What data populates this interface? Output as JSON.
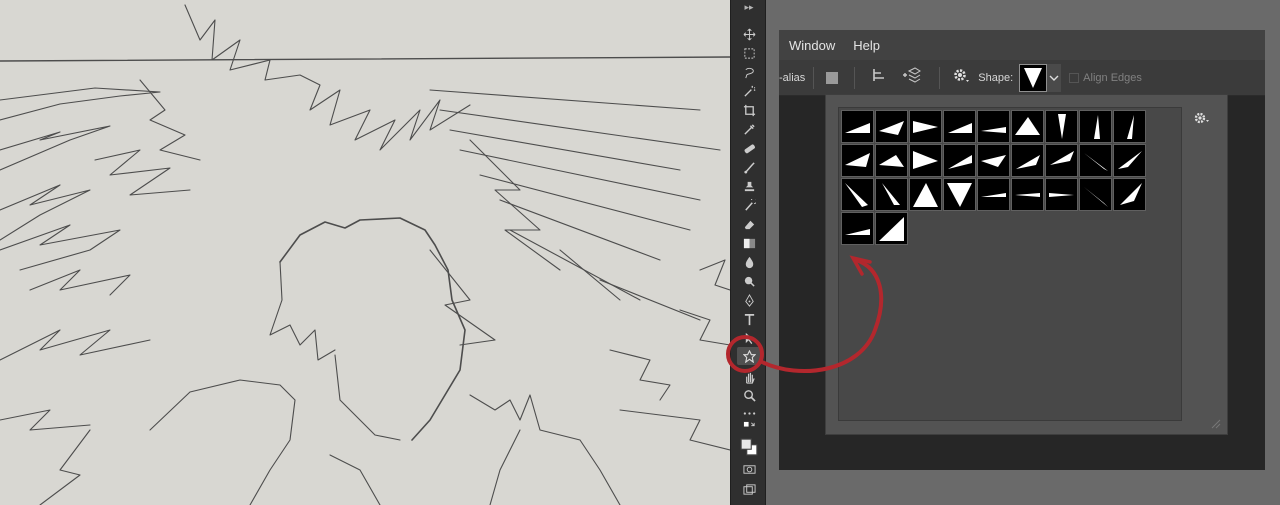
{
  "menu": {
    "items": [
      "Window",
      "Help"
    ]
  },
  "options": {
    "antialias_label": "-alias",
    "shape_label": "Shape:",
    "align_edges_label": "Align Edges"
  },
  "tools_panel": {
    "grip": "▸▸",
    "tools": [
      {
        "name": "move-tool-icon"
      },
      {
        "name": "marquee-tool-icon"
      },
      {
        "name": "lasso-tool-icon"
      },
      {
        "name": "magic-wand-tool-icon"
      },
      {
        "name": "crop-tool-icon"
      },
      {
        "name": "eyedropper-tool-icon"
      },
      {
        "name": "healing-brush-tool-icon"
      },
      {
        "name": "brush-tool-icon"
      },
      {
        "name": "clone-stamp-tool-icon"
      },
      {
        "name": "history-brush-tool-icon"
      },
      {
        "name": "eraser-tool-icon"
      },
      {
        "name": "gradient-tool-icon"
      },
      {
        "name": "blur-tool-icon"
      },
      {
        "name": "dodge-tool-icon"
      },
      {
        "name": "pen-tool-icon"
      },
      {
        "name": "type-tool-icon"
      },
      {
        "name": "path-selection-tool-icon"
      },
      {
        "name": "custom-shape-tool-icon",
        "active": true
      },
      {
        "name": "hand-tool-icon"
      },
      {
        "name": "zoom-tool-icon"
      },
      {
        "name": "more-tools-icon"
      }
    ]
  },
  "shape_picker": {
    "shape_count": 29
  },
  "colors": {
    "canvas": "#d8d7d2",
    "sketch_line": "#555555",
    "annotation": "#b3272d",
    "panel": "#535353"
  }
}
